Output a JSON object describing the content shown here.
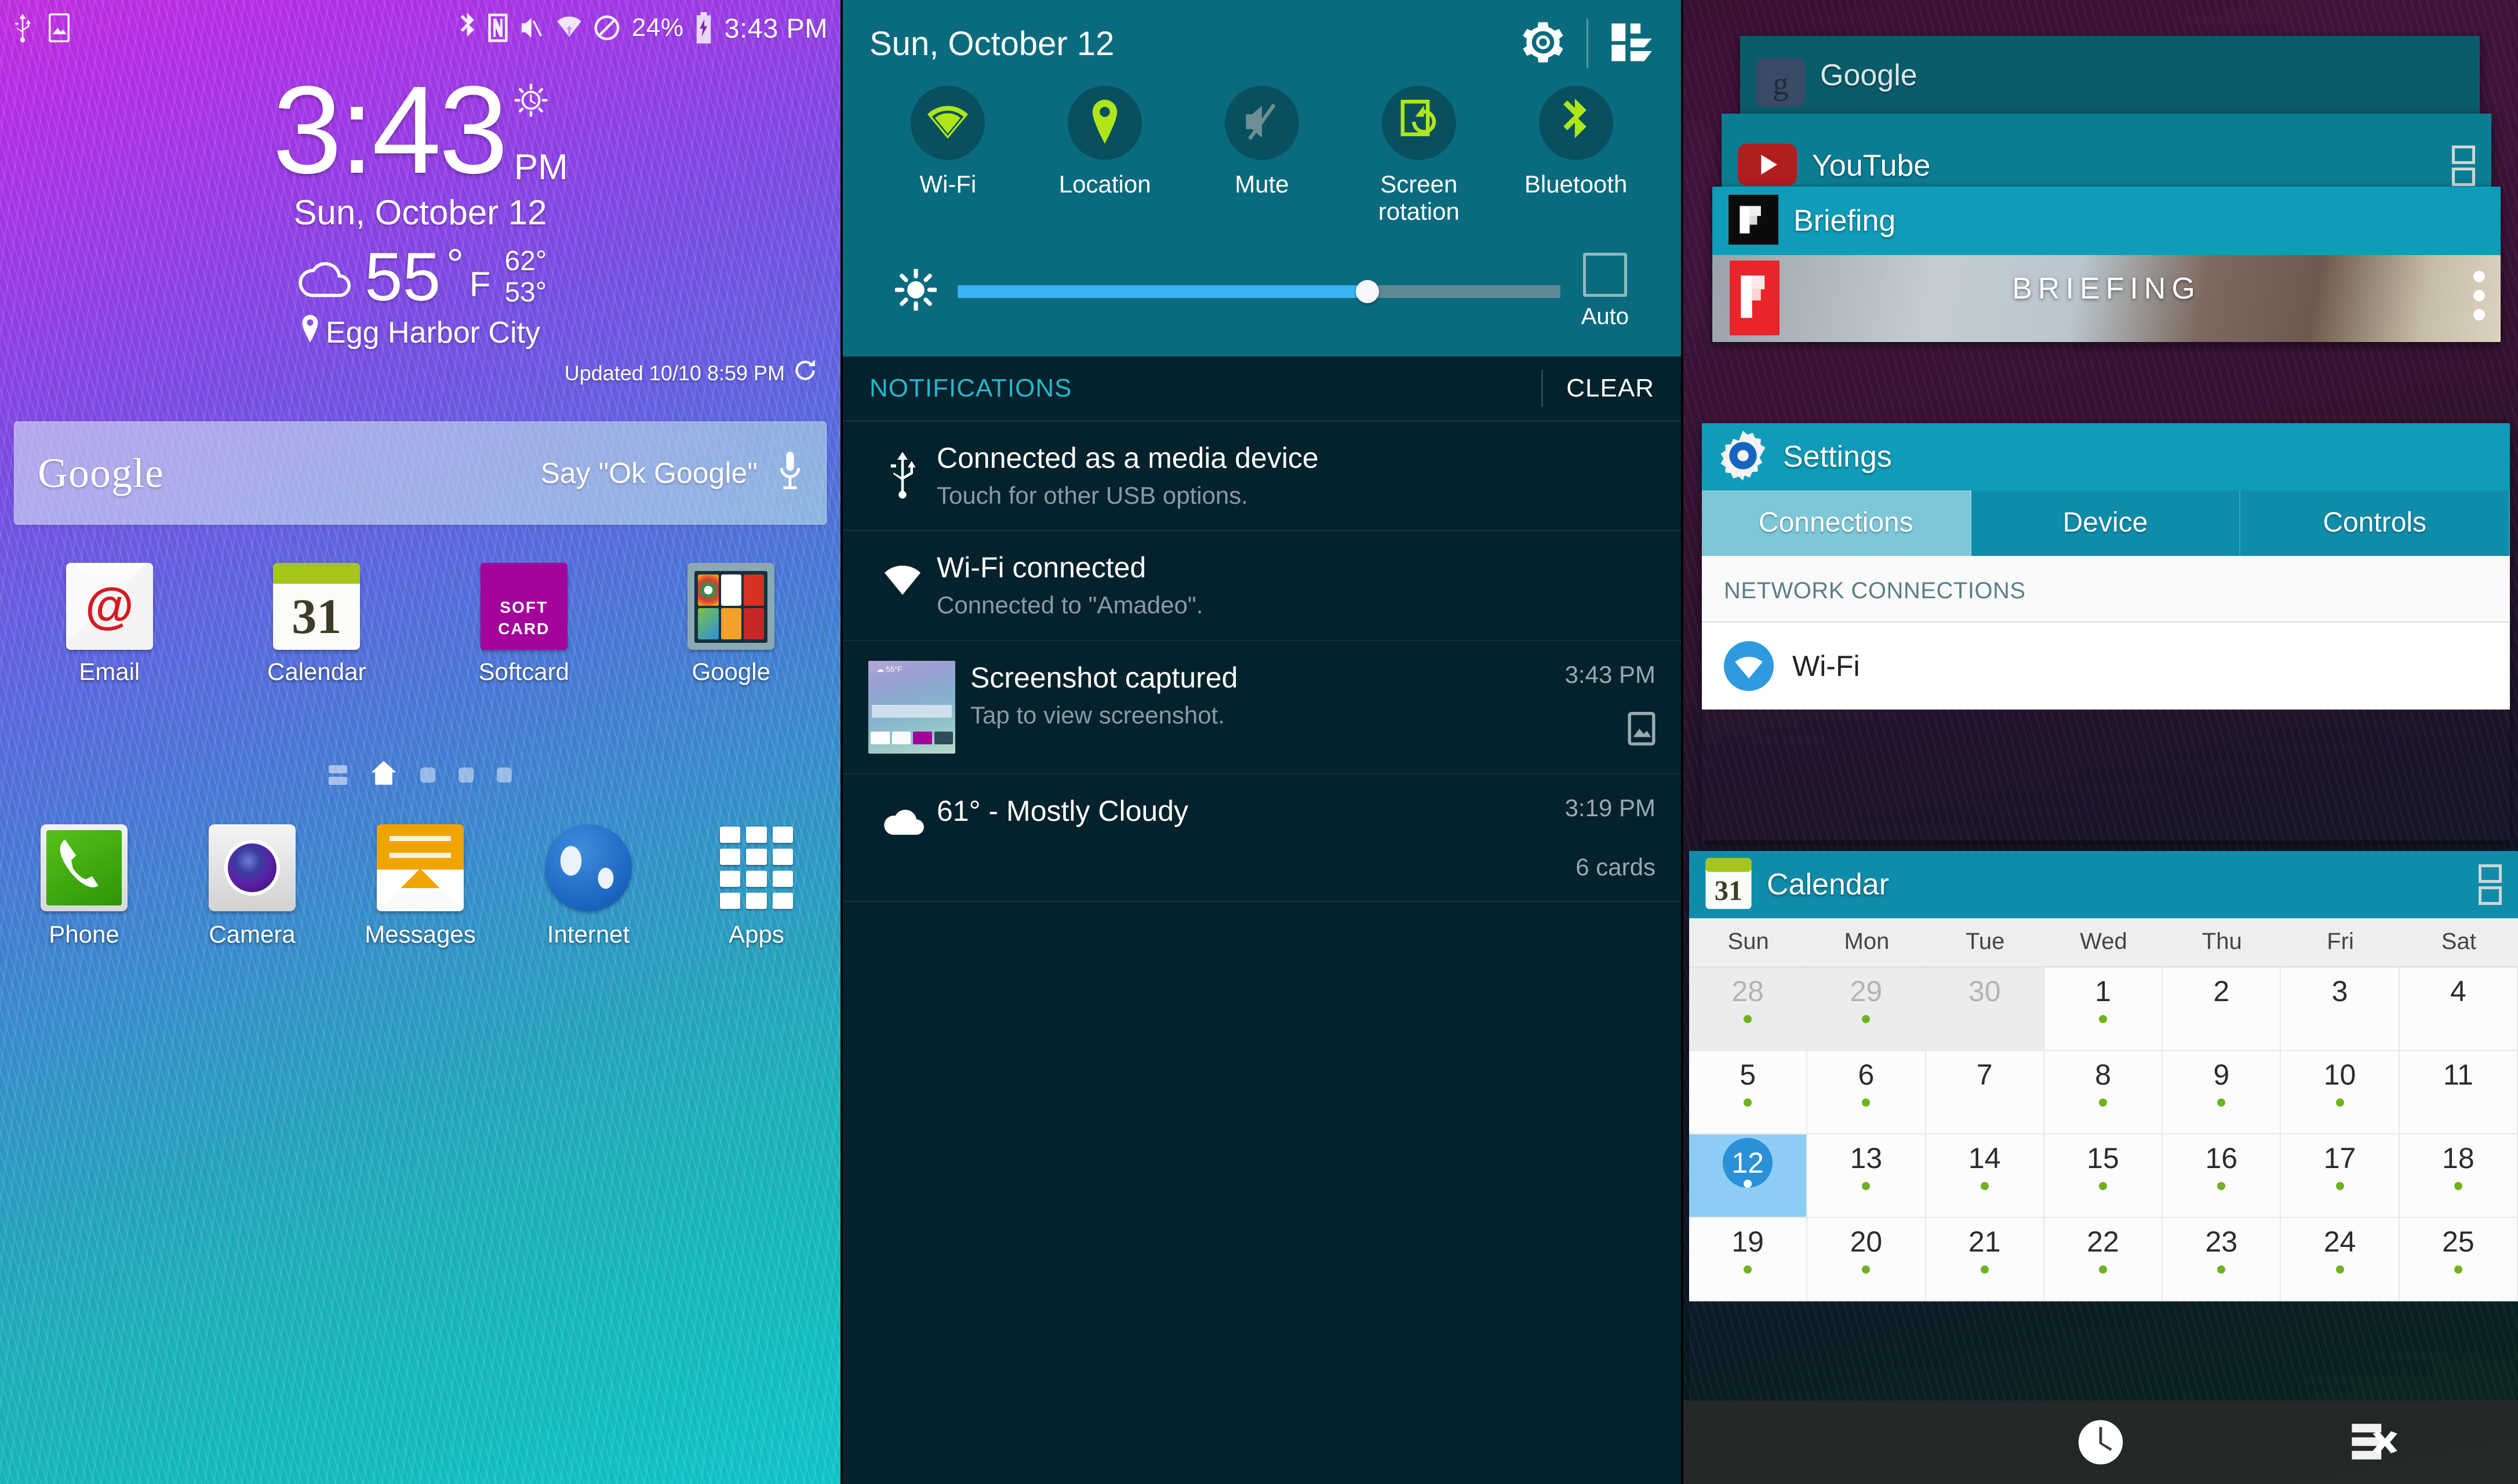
{
  "home": {
    "statusbar": {
      "icons_left": [
        "usb-icon",
        "screenshot-icon"
      ],
      "icons_right": [
        "bluetooth-icon",
        "nfc-icon",
        "mute-icon",
        "wifi-icon",
        "do-not-disturb-icon"
      ],
      "battery_percent": "24%",
      "time": "3:43 PM"
    },
    "clock": {
      "time": "3:43",
      "ampm": "PM",
      "date": "Sun, October 12",
      "alarm_icon": "alarm-clock-icon"
    },
    "weather": {
      "condition_icon": "cloud-icon",
      "temp": "55",
      "degree": "°",
      "unit": "F",
      "high": "62°",
      "low": "53°",
      "location": "Egg Harbor City",
      "updated": "Updated 10/10 8:59 PM",
      "refresh_icon": "refresh-icon"
    },
    "search": {
      "logo": "Google",
      "hint": "Say \"Ok Google\"",
      "mic_icon": "microphone-icon"
    },
    "apps": [
      {
        "label": "Email",
        "icon": "email-icon"
      },
      {
        "label": "Calendar",
        "icon": "calendar-icon",
        "day": "31"
      },
      {
        "label": "Softcard",
        "icon": "softcard-icon",
        "line1": "SOFT",
        "line2": "CARD"
      },
      {
        "label": "Google",
        "icon": "google-folder-icon"
      }
    ],
    "page_dots": {
      "count": 5,
      "active_index": 1
    },
    "dock": [
      {
        "label": "Phone",
        "icon": "phone-icon"
      },
      {
        "label": "Camera",
        "icon": "camera-icon"
      },
      {
        "label": "Messages",
        "icon": "messages-icon"
      },
      {
        "label": "Internet",
        "icon": "internet-globe-icon"
      },
      {
        "label": "Apps",
        "icon": "apps-grid-icon"
      }
    ]
  },
  "shade": {
    "date": "Sun, October 12",
    "settings_icon": "gear-icon",
    "edit_icon": "quick-settings-edit-icon",
    "toggles": [
      {
        "label": "Wi-Fi",
        "icon": "wifi-icon",
        "on": true
      },
      {
        "label": "Location",
        "icon": "location-pin-icon",
        "on": true
      },
      {
        "label": "Mute",
        "icon": "mute-icon",
        "on": false
      },
      {
        "label": "Screen\nrotation",
        "icon": "screen-rotation-icon",
        "on": true
      },
      {
        "label": "Bluetooth",
        "icon": "bluetooth-icon",
        "on": true
      }
    ],
    "toggle_labels": [
      "Wi-Fi",
      "Location",
      "Mute",
      "Screen rotation",
      "Bluetooth"
    ],
    "brightness": {
      "icon": "brightness-icon",
      "value_percent": 68,
      "auto_label": "Auto",
      "auto_checked": false
    },
    "notifications_header": {
      "title": "NOTIFICATIONS",
      "clear_label": "CLEAR"
    },
    "notifications": [
      {
        "icon": "usb-icon",
        "title": "Connected as a media device",
        "sub": "Touch for other USB options.",
        "time": "",
        "extra": ""
      },
      {
        "icon": "wifi-icon",
        "title": "Wi-Fi connected",
        "sub": "Connected to \"Amadeo\".",
        "time": "",
        "extra": ""
      },
      {
        "icon": "screenshot-thumbnail",
        "title": "Screenshot captured",
        "sub": "Tap to view screenshot.",
        "time": "3:43 PM",
        "extra": "",
        "badge": "image-icon"
      },
      {
        "icon": "cloud-icon",
        "title": "61° - Mostly Cloudy",
        "sub": "",
        "time": "3:19 PM",
        "extra": "6 cards"
      }
    ]
  },
  "recents": {
    "cards": [
      {
        "title": "Google",
        "icon": "google-icon",
        "bar_color": "#0a5c6b"
      },
      {
        "title": "YouTube",
        "icon": "youtube-icon",
        "bar_color": "#0b7d92",
        "split_icon": "split-screen-icon"
      },
      {
        "title": "Briefing",
        "icon": "flipboard-icon",
        "bar_color": "#0f9cb8",
        "banner_text": "BRIEFING"
      },
      {
        "title": "Settings",
        "icon": "settings-gear-icon",
        "bar_color": "#0f9cb8"
      },
      {
        "title": "Calendar",
        "icon": "calendar-icon",
        "bar_color": "#0f8caa",
        "split_icon": "split-screen-icon"
      }
    ],
    "settings": {
      "tabs": [
        "Connections",
        "Device",
        "Controls"
      ],
      "active_tab": "Connections",
      "section_header": "NETWORK CONNECTIONS",
      "rows": [
        {
          "label": "Wi-Fi",
          "icon": "wifi-icon"
        }
      ]
    },
    "calendar": {
      "day_badge": "31",
      "weekdays": [
        "Sun",
        "Mon",
        "Tue",
        "Wed",
        "Thu",
        "Fri",
        "Sat"
      ],
      "today": 12,
      "weeks": [
        [
          {
            "d": "28",
            "out": true,
            "dot": true
          },
          {
            "d": "29",
            "out": true,
            "dot": true
          },
          {
            "d": "30",
            "out": true,
            "dot": false
          },
          {
            "d": "1",
            "out": false,
            "dot": true
          },
          {
            "d": "2",
            "out": false,
            "dot": false
          },
          {
            "d": "3",
            "out": false,
            "dot": false
          },
          {
            "d": "4",
            "out": false,
            "dot": false
          }
        ],
        [
          {
            "d": "5",
            "out": false,
            "dot": true
          },
          {
            "d": "6",
            "out": false,
            "dot": true
          },
          {
            "d": "7",
            "out": false,
            "dot": false
          },
          {
            "d": "8",
            "out": false,
            "dot": true
          },
          {
            "d": "9",
            "out": false,
            "dot": true
          },
          {
            "d": "10",
            "out": false,
            "dot": true
          },
          {
            "d": "11",
            "out": false,
            "dot": false
          }
        ],
        [
          {
            "d": "12",
            "out": false,
            "dot": true,
            "today": true
          },
          {
            "d": "13",
            "out": false,
            "dot": true
          },
          {
            "d": "14",
            "out": false,
            "dot": true
          },
          {
            "d": "15",
            "out": false,
            "dot": true
          },
          {
            "d": "16",
            "out": false,
            "dot": true
          },
          {
            "d": "17",
            "out": false,
            "dot": true
          },
          {
            "d": "18",
            "out": false,
            "dot": true
          }
        ],
        [
          {
            "d": "19",
            "out": false,
            "dot": true
          },
          {
            "d": "20",
            "out": false,
            "dot": true
          },
          {
            "d": "21",
            "out": false,
            "dot": true
          },
          {
            "d": "22",
            "out": false,
            "dot": true
          },
          {
            "d": "23",
            "out": false,
            "dot": true
          },
          {
            "d": "24",
            "out": false,
            "dot": true
          },
          {
            "d": "25",
            "out": false,
            "dot": true
          }
        ]
      ]
    },
    "navbar": {
      "recent_icon": "recent-apps-icon",
      "home_icon": "home-icon",
      "back_icon": "back-icon",
      "clock_icon": "clock-icon",
      "close-all_icon": "close-all-icon"
    }
  },
  "colors": {
    "accent_teal": "#0f9cb8",
    "shade_bg": "#04222b",
    "qs_bg": "#0a6b7e",
    "toggle_on": "#b0e619",
    "slider_fill": "#39b2f5",
    "notif_label": "#27b5cc",
    "cal_dot": "#6db31f",
    "today_blue": "#2a90d8"
  }
}
